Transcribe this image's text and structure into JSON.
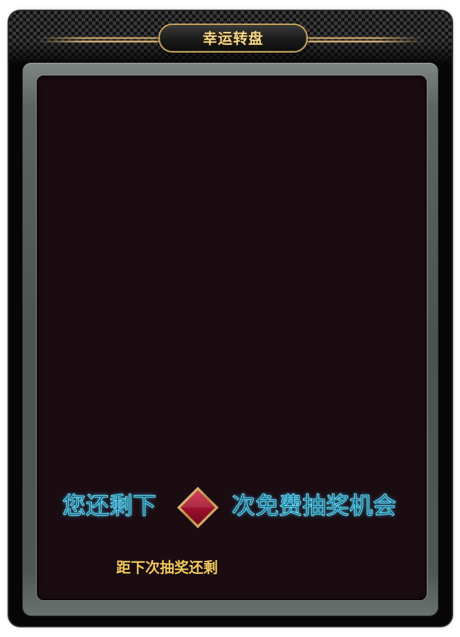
{
  "title": "幸运转盘",
  "free_chances": {
    "prefix": "您还剩下",
    "suffix": "次免费抽奖机会",
    "icon": "red-diamond-icon"
  },
  "countdown": {
    "label": "距下次抽奖还剩"
  },
  "colors": {
    "title_gold": "#f7d98a",
    "panel_bg": "#1b0c12",
    "glow_text": "#6ee0ff",
    "countdown_text": "#f4c95e",
    "diamond_red": "#a81432"
  }
}
